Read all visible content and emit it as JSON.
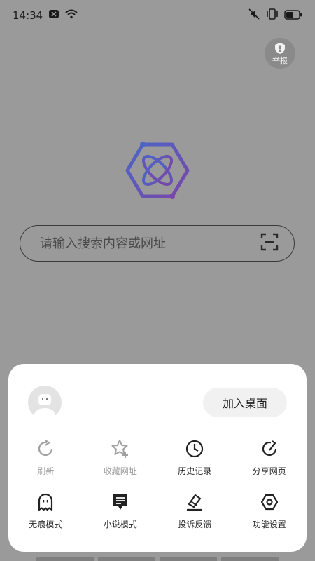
{
  "status_bar": {
    "time": "14:34"
  },
  "report_button": {
    "label": "举报"
  },
  "search": {
    "placeholder": "请输入搜索内容或网址"
  },
  "menu": {
    "add_desktop_label": "加入桌面",
    "items": [
      {
        "label": "刷新",
        "icon": "refresh-icon",
        "enabled": false
      },
      {
        "label": "收藏网址",
        "icon": "favorite-star-icon",
        "enabled": false
      },
      {
        "label": "历史记录",
        "icon": "history-clock-icon",
        "enabled": true
      },
      {
        "label": "分享网页",
        "icon": "share-icon",
        "enabled": true
      },
      {
        "label": "无痕模式",
        "icon": "ghost-icon",
        "enabled": true
      },
      {
        "label": "小说模式",
        "icon": "novel-icon",
        "enabled": true
      },
      {
        "label": "投诉反馈",
        "icon": "feedback-icon",
        "enabled": true
      },
      {
        "label": "功能设置",
        "icon": "settings-hexagon-icon",
        "enabled": true
      }
    ]
  },
  "colors": {
    "accent": "#6a4fb6",
    "overlay": "#9a9a9a",
    "sheet": "#ffffff"
  }
}
